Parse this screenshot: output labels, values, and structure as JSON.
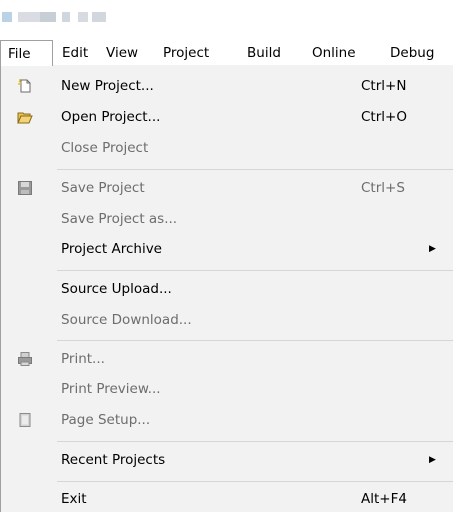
{
  "menubar": {
    "items": [
      {
        "label": "File"
      },
      {
        "label": "Edit"
      },
      {
        "label": "View"
      },
      {
        "label": "Project"
      },
      {
        "label": "Build"
      },
      {
        "label": "Online"
      },
      {
        "label": "Debug"
      }
    ]
  },
  "file_menu": {
    "items": [
      {
        "label": "New Project...",
        "shortcut": "Ctrl+N",
        "enabled": true,
        "icon": "new-document-icon"
      },
      {
        "label": "Open Project...",
        "shortcut": "Ctrl+O",
        "enabled": true,
        "icon": "open-folder-icon"
      },
      {
        "label": "Close Project",
        "shortcut": "",
        "enabled": false
      },
      {
        "label": "Save Project",
        "shortcut": "Ctrl+S",
        "enabled": false,
        "icon": "save-disk-icon"
      },
      {
        "label": "Save Project as...",
        "shortcut": "",
        "enabled": false
      },
      {
        "label": "Project Archive",
        "shortcut": "",
        "enabled": true,
        "submenu": true
      },
      {
        "label": "Source Upload...",
        "shortcut": "",
        "enabled": true
      },
      {
        "label": "Source Download...",
        "shortcut": "",
        "enabled": false
      },
      {
        "label": "Print...",
        "shortcut": "",
        "enabled": false,
        "icon": "printer-icon"
      },
      {
        "label": "Print Preview...",
        "shortcut": "",
        "enabled": false
      },
      {
        "label": "Page Setup...",
        "shortcut": "",
        "enabled": false,
        "icon": "page-setup-icon"
      },
      {
        "label": "Recent Projects",
        "shortcut": "",
        "enabled": true,
        "submenu": true
      },
      {
        "label": "Exit",
        "shortcut": "Alt+F4",
        "enabled": true
      }
    ],
    "submenu_arrow": "▶"
  },
  "colors": {
    "menu_background": "#f2f2f2",
    "disabled_text": "#6d6d6d",
    "separator": "#d6d6d6",
    "active_menu_border": "#a0a0a0"
  }
}
